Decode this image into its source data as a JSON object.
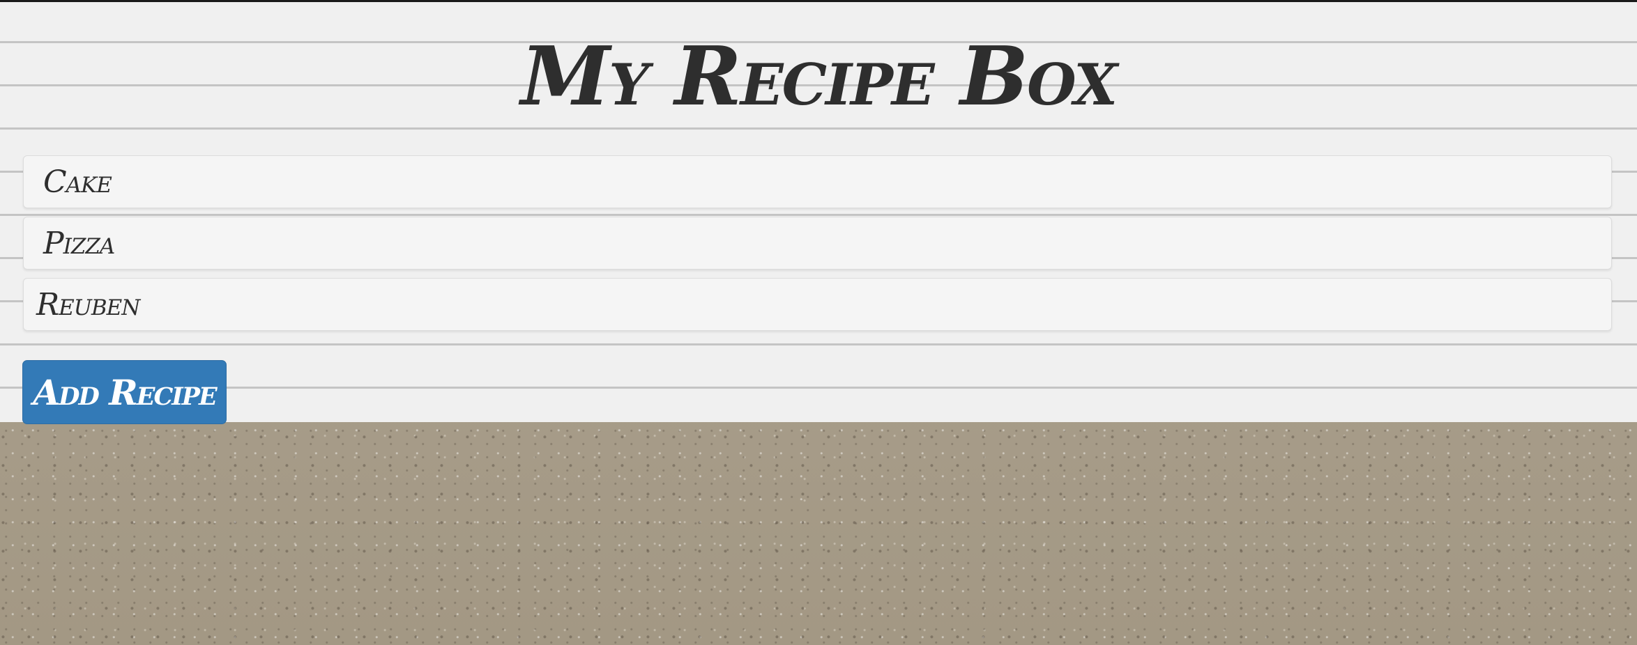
{
  "page": {
    "title": "My Recipe Box"
  },
  "recipes": [
    {
      "name": "Cake"
    },
    {
      "name": "Pizza"
    },
    {
      "name": "Reuben"
    }
  ],
  "actions": {
    "add_recipe_label": "Add Recipe"
  },
  "colors": {
    "paper": "#f0f0f0",
    "paper_lines": "#c4c4c4",
    "background_cardboard": "#a89d8c",
    "list_item_bg": "#f5f5f5",
    "text": "#2e2e2e",
    "primary_button": "#337ab7"
  }
}
